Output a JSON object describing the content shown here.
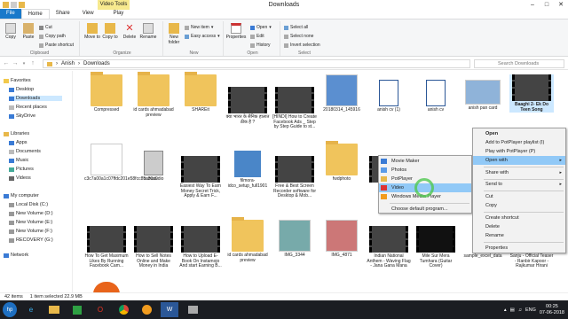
{
  "window": {
    "title": "Downloads",
    "context_tab": "Video Tools"
  },
  "tabs": [
    "File",
    "Home",
    "Share",
    "View",
    "Play"
  ],
  "ribbon": {
    "clipboard": {
      "copy": "Copy",
      "paste": "Paste",
      "cut": "Cut",
      "copy_path": "Copy path",
      "paste_shortcut": "Paste shortcut",
      "label": "Clipboard"
    },
    "organize": {
      "move_to": "Move to",
      "copy_to": "Copy to",
      "delete": "Delete",
      "rename": "Rename",
      "label": "Organize"
    },
    "new": {
      "new_folder": "New folder",
      "new_item": "New item",
      "easy_access": "Easy access",
      "label": "New"
    },
    "open": {
      "properties": "Properties",
      "open": "Open",
      "edit": "Edit",
      "history": "History",
      "label": "Open"
    },
    "select": {
      "select_all": "Select all",
      "select_none": "Select none",
      "invert": "Invert selection",
      "label": "Select"
    }
  },
  "address": {
    "path": [
      "Anish",
      "Downloads"
    ],
    "search_placeholder": "Search Downloads"
  },
  "nav": {
    "favorites": "Favorites",
    "desktop": "Desktop",
    "downloads": "Downloads",
    "recent": "Recent places",
    "skydrive": "SkyDrive",
    "libraries": "Libraries",
    "apps": "Apps",
    "documents": "Documents",
    "music": "Music",
    "pictures": "Pictures",
    "videos": "Videos",
    "computer": "My computer",
    "c": "Local Disk (C:)",
    "d": "New Volume (D:)",
    "e": "New Volume (E:)",
    "f": "New Volume (F:)",
    "g": "RECOVERY (G:)",
    "network": "Network"
  },
  "files": {
    "r1": [
      "Compressed",
      "id cards ahmadabad preview",
      "SHAREit",
      "क्या भारत के सैनिक हालात ठीक है ?",
      "[HINDI] How to Create Facebook Ads _ Step by Step Guide to st...",
      "20180314_145916",
      "anish cv (1)",
      "anish cv",
      "anish pan card",
      "Baaghi 2- Ek Do Teen Song"
    ],
    "r2": [
      "c3c7a00a1c07ffdc201e58fcc85c30a9",
      "camstudio",
      "Easiest Way To Earn Money Secret Trick, Apply & Earn F...",
      "filmora-idco_setup_full1901",
      "Free & Best Screen Recorder software for Desktop & Mob...",
      "fwdphoto"
    ],
    "r3": [
      "How To Get Maximum Likes By Running Facebook Cam...",
      "How to Sell Notes Online and Make Money in India",
      "How to Upload E-Book On Instamojo And start Earning B...",
      "id cards ahmadabad preview",
      "IMG_3344",
      "IMG_4871",
      "Indian National Anthem - Waving Flag - Jana Gana Mana",
      "Mile Sur Mera Tumhara (Guitar Cover)",
      "sample_excel_data",
      "Sanju - Official Teaser - Ranbir Kapoor - Rajkumar Hirani"
    ]
  },
  "status": {
    "count": "42 items",
    "selected": "1 item selected  22.9 MB"
  },
  "taskbar": {
    "lang": "ENG",
    "time": "00:25",
    "date": "07-06-2018"
  },
  "context_menu": {
    "items": [
      "Open",
      "Add to PotPlayer playlist (I)",
      "Play with PotPlayer (P)",
      "Open with",
      "Share with",
      "Send to",
      "Cut",
      "Copy",
      "Create shortcut",
      "Delete",
      "Rename",
      "Properties"
    ]
  },
  "open_with_menu": {
    "items": [
      "Movie Maker",
      "Photos",
      "PotPlayer",
      "Video",
      "Windows Media Player",
      "Choose default program..."
    ]
  }
}
